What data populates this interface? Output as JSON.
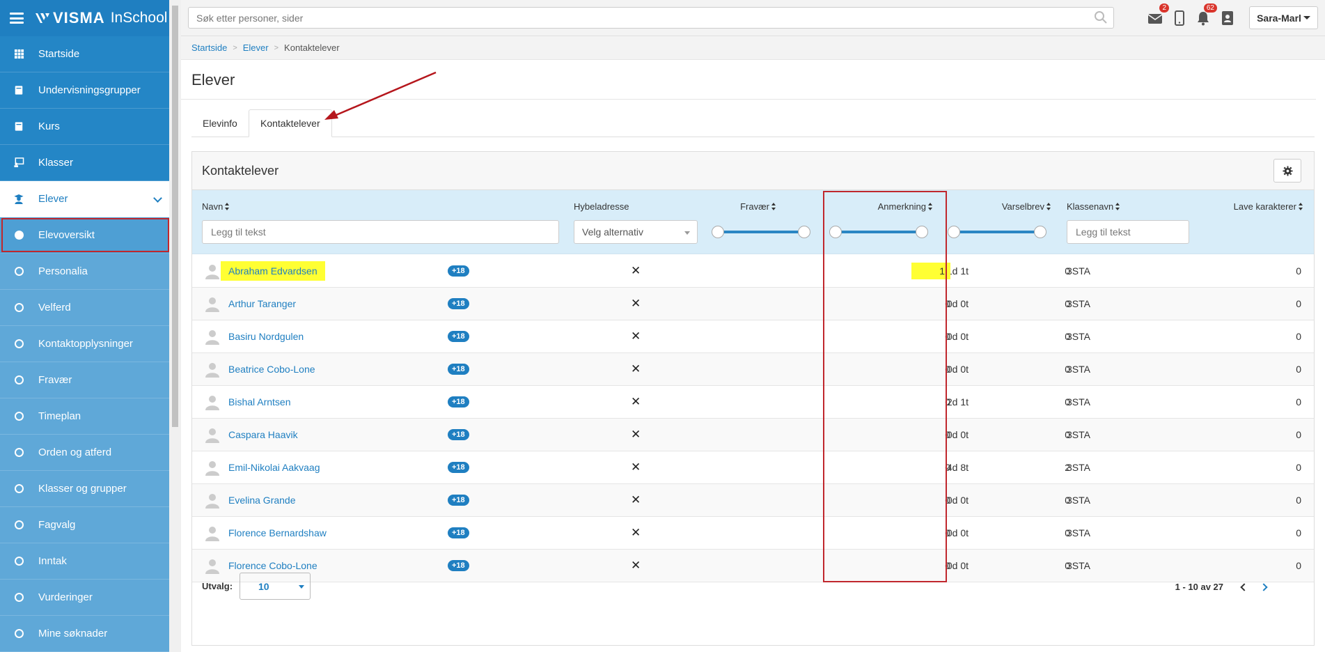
{
  "app": {
    "brand": "VISMA",
    "product": "InSchool"
  },
  "sidebar": {
    "items": [
      {
        "label": "Startside",
        "icon": "grid-icon"
      },
      {
        "label": "Undervisningsgrupper",
        "icon": "book-icon"
      },
      {
        "label": "Kurs",
        "icon": "book-icon"
      },
      {
        "label": "Klasser",
        "icon": "classroom-icon"
      },
      {
        "label": "Elever",
        "icon": "student-icon"
      }
    ],
    "subitems": [
      {
        "label": "Elevoversikt",
        "selected": true
      },
      {
        "label": "Personalia"
      },
      {
        "label": "Velferd"
      },
      {
        "label": "Kontaktopplysninger"
      },
      {
        "label": "Fravær"
      },
      {
        "label": "Timeplan"
      },
      {
        "label": "Orden og atferd"
      },
      {
        "label": "Klasser og grupper"
      },
      {
        "label": "Fagvalg"
      },
      {
        "label": "Inntak"
      },
      {
        "label": "Vurderinger"
      },
      {
        "label": "Mine søknader"
      }
    ]
  },
  "topbar": {
    "search_placeholder": "Søk etter personer, sider",
    "mail_badge": "2",
    "notif_badge": "62",
    "user": "Sara-Marl"
  },
  "breadcrumb": [
    "Startside",
    "Elever",
    "Kontaktelever"
  ],
  "page": {
    "title": "Elever"
  },
  "tabs": [
    "Elevinfo",
    "Kontaktelever"
  ],
  "panel": {
    "title": "Kontaktelever",
    "columns": {
      "navn": "Navn",
      "hybel": "Hybeladresse",
      "fravaer": "Fravær",
      "anmerkning": "Anmerkning",
      "varselbrev": "Varselbrev",
      "klassenavn": "Klassenavn",
      "lave": "Lave karakterer"
    },
    "filter_text_placeholder": "Legg til tekst",
    "filter_select_label": "Velg alternativ",
    "rows": [
      {
        "name": "Abraham Edvardsen",
        "age": "+18",
        "fravaer": "1d 1t",
        "anmerkning": "1",
        "varselbrev": "0",
        "klasse": "3STA",
        "lave": "0"
      },
      {
        "name": "Arthur Taranger",
        "age": "+18",
        "fravaer": "0d 0t",
        "anmerkning": "0",
        "varselbrev": "0",
        "klasse": "3STA",
        "lave": "0"
      },
      {
        "name": "Basiru Nordgulen",
        "age": "+18",
        "fravaer": "0d 0t",
        "anmerkning": "0",
        "varselbrev": "0",
        "klasse": "3STA",
        "lave": "0"
      },
      {
        "name": "Beatrice Cobo-Lone",
        "age": "+18",
        "fravaer": "0d 0t",
        "anmerkning": "0",
        "varselbrev": "0",
        "klasse": "3STA",
        "lave": "0"
      },
      {
        "name": "Bishal Arntsen",
        "age": "+18",
        "fravaer": "2d 1t",
        "anmerkning": "0",
        "varselbrev": "0",
        "klasse": "3STA",
        "lave": "0"
      },
      {
        "name": "Caspara Haavik",
        "age": "+18",
        "fravaer": "0d 0t",
        "anmerkning": "0",
        "varselbrev": "0",
        "klasse": "3STA",
        "lave": "0"
      },
      {
        "name": "Emil-Nikolai Aakvaag",
        "age": "+18",
        "fravaer": "4d 8t",
        "anmerkning": "0",
        "varselbrev": "2",
        "klasse": "3STA",
        "lave": "0"
      },
      {
        "name": "Evelina Grande",
        "age": "+18",
        "fravaer": "0d 0t",
        "anmerkning": "0",
        "varselbrev": "0",
        "klasse": "3STA",
        "lave": "0"
      },
      {
        "name": "Florence Bernardshaw",
        "age": "+18",
        "fravaer": "0d 0t",
        "anmerkning": "0",
        "varselbrev": "0",
        "klasse": "3STA",
        "lave": "0"
      },
      {
        "name": "Florence Cobo-Lone",
        "age": "+18",
        "fravaer": "0d 0t",
        "anmerkning": "0",
        "varselbrev": "0",
        "klasse": "3STA",
        "lave": "0"
      }
    ],
    "footer": {
      "utvalg_label": "Utvalg:",
      "utvalg_value": "10",
      "pager": "1 - 10 av 27"
    }
  },
  "colors": {
    "brand": "#1f7fc1",
    "sidebar": "#5fa8d8",
    "highlight": "#ffff33",
    "annotation": "#c0272d"
  }
}
